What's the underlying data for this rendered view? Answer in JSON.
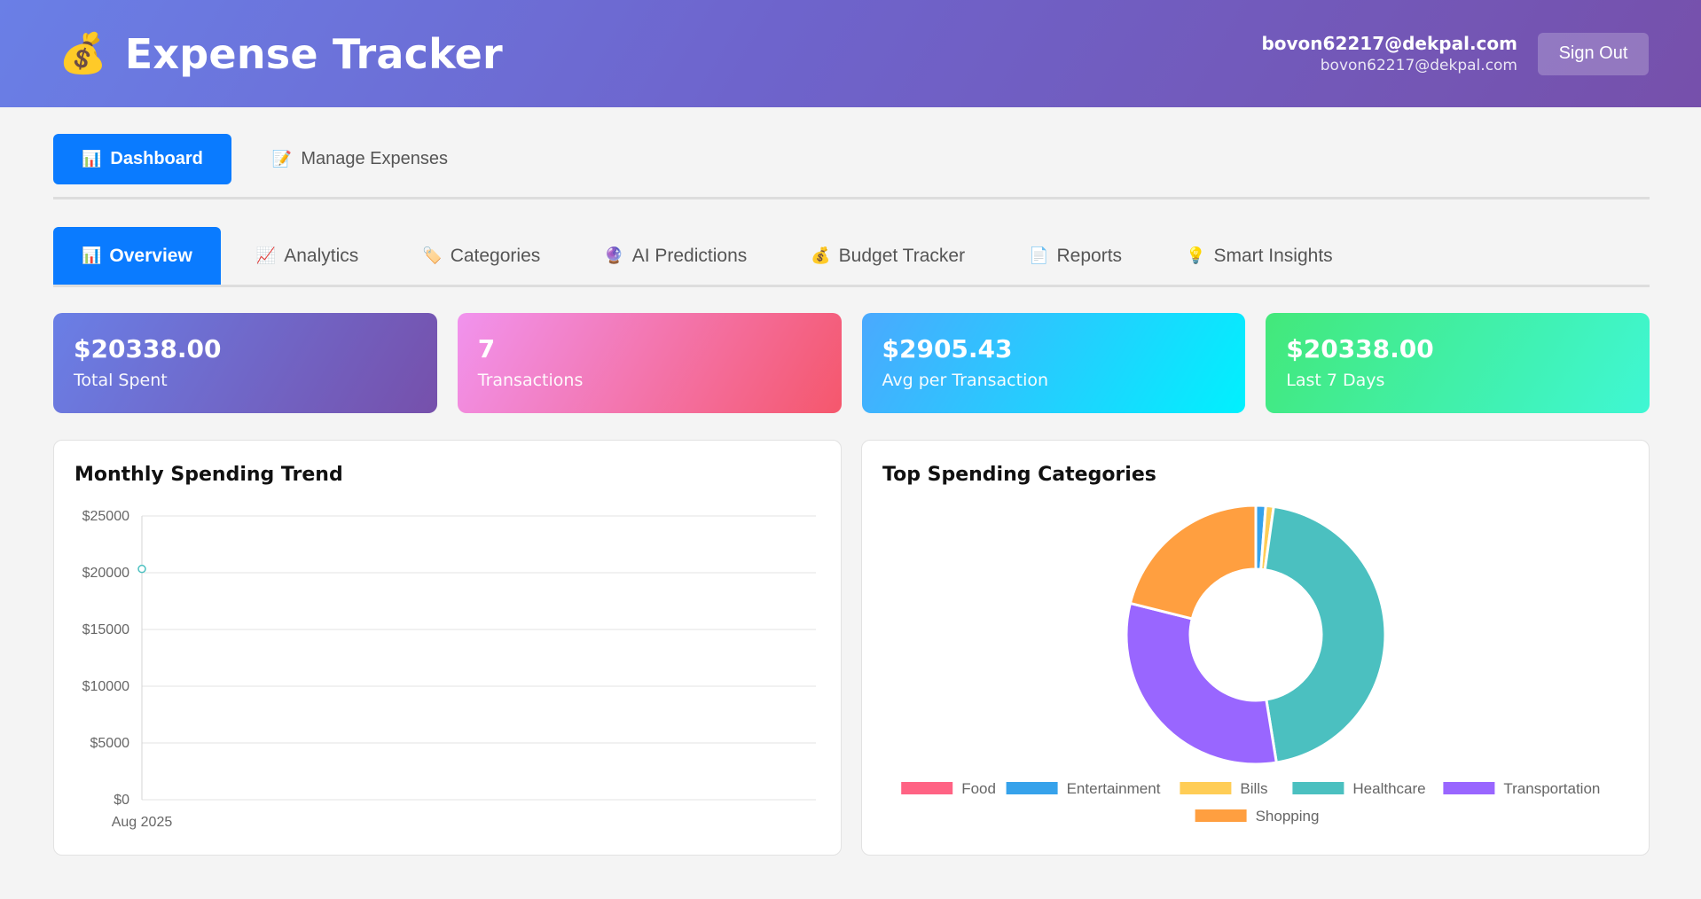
{
  "header": {
    "icon": "money-bag-icon",
    "icon_glyph": "💰",
    "title": "Expense Tracker",
    "user_email": "bovon62217@dekpal.com",
    "user_subemail": "bovon62217@dekpal.com",
    "signout_label": "Sign Out"
  },
  "main_nav": [
    {
      "icon": "📊",
      "icon_name": "bar-chart-icon",
      "label": "Dashboard",
      "active": true
    },
    {
      "icon": "📝",
      "icon_name": "memo-icon",
      "label": "Manage Expenses",
      "active": false
    }
  ],
  "sub_tabs": [
    {
      "icon": "📊",
      "icon_name": "bar-chart-icon",
      "label": "Overview",
      "active": true
    },
    {
      "icon": "📈",
      "icon_name": "trend-chart-icon",
      "label": "Analytics",
      "active": false
    },
    {
      "icon": "🏷️",
      "icon_name": "tag-icon",
      "label": "Categories",
      "active": false
    },
    {
      "icon": "🔮",
      "icon_name": "crystal-ball-icon",
      "label": "AI Predictions",
      "active": false
    },
    {
      "icon": "💰",
      "icon_name": "money-bag-icon",
      "label": "Budget Tracker",
      "active": false
    },
    {
      "icon": "📄",
      "icon_name": "document-icon",
      "label": "Reports",
      "active": false
    },
    {
      "icon": "💡",
      "icon_name": "lightbulb-icon",
      "label": "Smart Insights",
      "active": false
    }
  ],
  "stats": [
    {
      "value": "$20338.00",
      "label": "Total Spent"
    },
    {
      "value": "7",
      "label": "Transactions"
    },
    {
      "value": "$2905.43",
      "label": "Avg per Transaction"
    },
    {
      "value": "$20338.00",
      "label": "Last 7 Days"
    }
  ],
  "panels": {
    "trend_title": "Monthly Spending Trend",
    "categories_title": "Top Spending Categories"
  },
  "chart_data": [
    {
      "type": "line",
      "title": "Monthly Spending Trend",
      "x": [
        "Aug 2025"
      ],
      "series": [
        {
          "values": [
            20338
          ],
          "color": "#4bc0c0"
        }
      ],
      "ylim": [
        0,
        25000
      ],
      "yticks": [
        "$0",
        "$5000",
        "$10000",
        "$15000",
        "$20000",
        "$25000"
      ],
      "grid": true
    },
    {
      "type": "pie",
      "title": "Top Spending Categories",
      "donut": true,
      "categories": [
        "Food",
        "Entertainment",
        "Bills",
        "Healthcare",
        "Transportation",
        "Shopping"
      ],
      "values": [
        0.02,
        250,
        200,
        9200,
        6400,
        4288
      ],
      "colors": [
        "#ff6384",
        "#36a2eb",
        "#ffcd56",
        "#4bc0c0",
        "#9966ff",
        "#ff9f40"
      ],
      "legend": "bottom"
    }
  ]
}
